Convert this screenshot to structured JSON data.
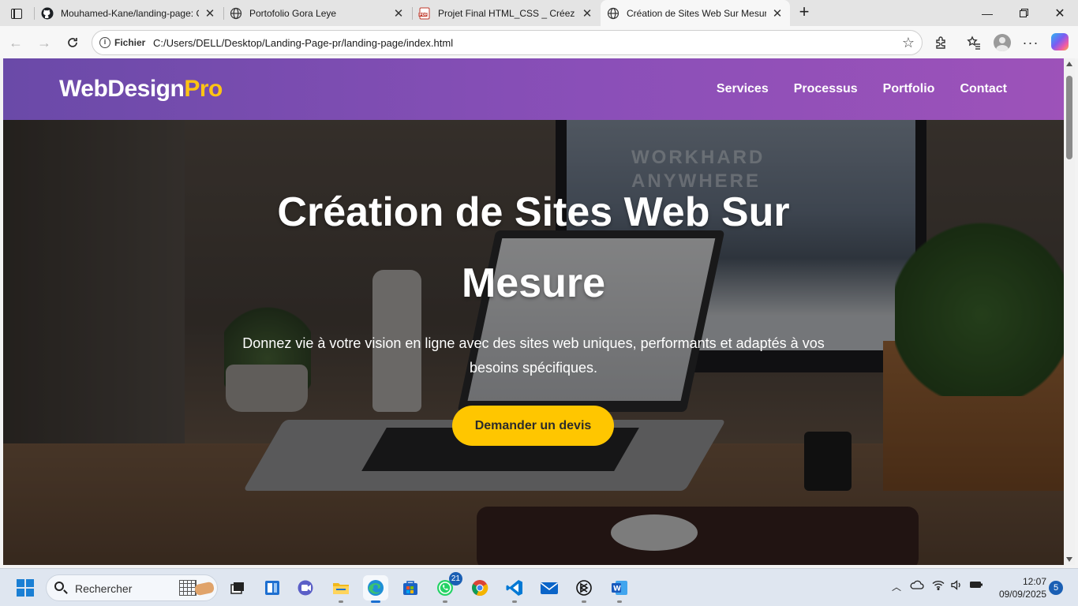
{
  "browser": {
    "tabs": [
      {
        "title": "Mouhamed-Kane/landing-page: C",
        "icon": "github-icon"
      },
      {
        "title": "Portofolio Gora Leye",
        "icon": "globe-icon"
      },
      {
        "title": "Projet Final HTML_CSS _ Créez Vo",
        "icon": "pdf-icon"
      },
      {
        "title": "Création de Sites Web Sur Mesure",
        "icon": "globe-icon",
        "active": true
      }
    ],
    "address": {
      "scheme": "Fichier",
      "url": "C:/Users/DELL/Desktop/Landing-Page-pr/landing-page/index.html"
    }
  },
  "site": {
    "logo_main": "WebDesign",
    "logo_accent": "Pro",
    "nav": [
      "Services",
      "Processus",
      "Portfolio",
      "Contact"
    ],
    "hero": {
      "title": "Création de Sites Web Sur Mesure",
      "subtitle": "Donnez vie à votre vision en ligne avec des sites web uniques, performants et adaptés à vos besoins spécifiques.",
      "cta": "Demander un devis",
      "background_words": [
        "WORKHARD",
        "ANYWHERE"
      ]
    },
    "colors": {
      "header": "#8a4fb8",
      "accent": "#ffc414",
      "cta": "#ffc600"
    }
  },
  "taskbar": {
    "search_placeholder": "Rechercher",
    "whatsapp_badge": "21",
    "time": "12:07",
    "date": "09/09/2025",
    "notifications": "5"
  }
}
